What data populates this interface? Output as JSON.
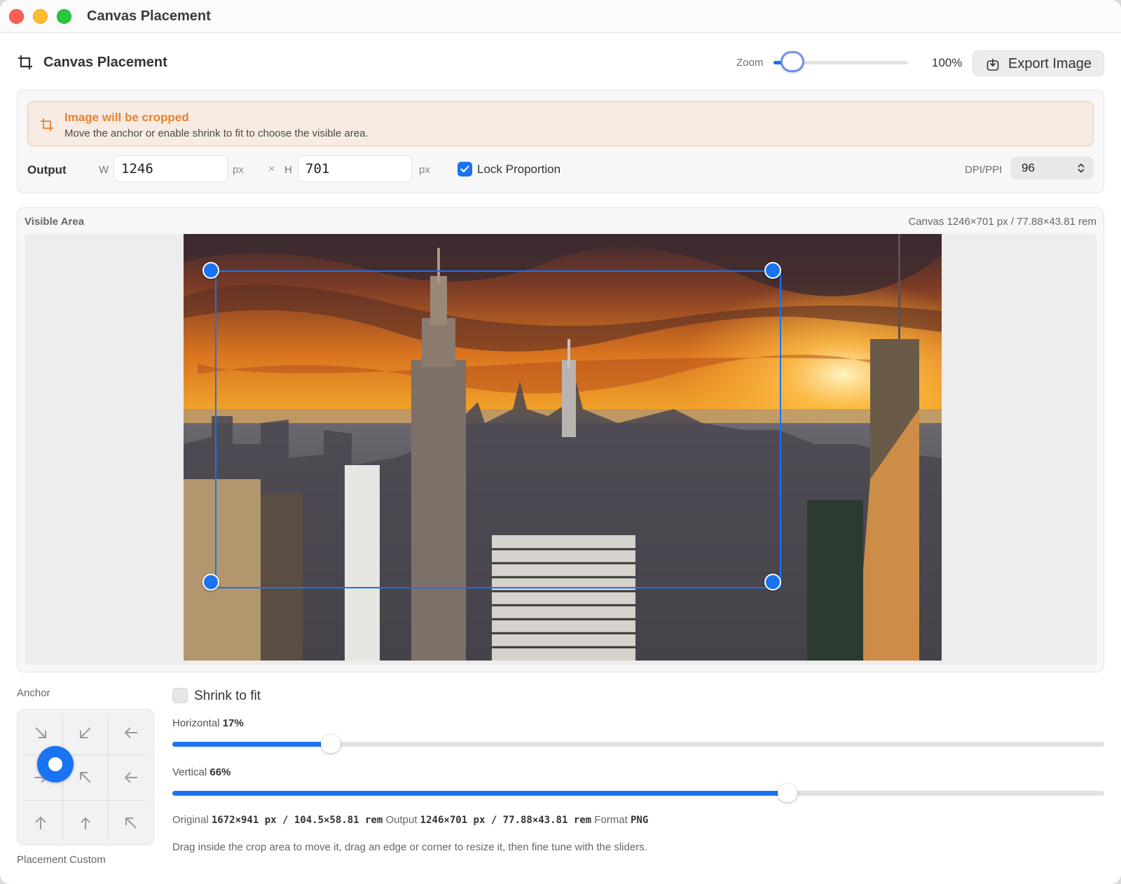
{
  "window": {
    "title": "Canvas Placement"
  },
  "toolbar": {
    "title": "Canvas Placement",
    "zoom_label": "Zoom",
    "zoom_value": "100%",
    "zoom_slider_fraction": 0.14,
    "export_label": "Export Image"
  },
  "warning": {
    "title": "Image will be cropped",
    "description": "Move the anchor or enable shrink to fit to choose the visible area."
  },
  "output": {
    "label": "Output",
    "w_label": "W",
    "width": "1246",
    "h_label": "H",
    "height": "701",
    "unit": "px",
    "times": "×",
    "lock_label": "Lock Proportion",
    "lock_checked": true,
    "dpi_label": "DPI/PPI",
    "dpi_value": "96"
  },
  "visible_area": {
    "label": "Visible Area",
    "canvas_info": "Canvas 1246×701 px / 77.88×43.81 rem"
  },
  "anchor": {
    "label": "Anchor",
    "placement": "Placement Custom",
    "icons": [
      "arrow-down-right-icon",
      "arrow-down-left-icon",
      "arrow-left-icon",
      "arrow-right-icon",
      "arrow-up-left-icon",
      "arrow-left-icon",
      "arrow-up-icon",
      "arrow-up-left-icon",
      "arrow-up-left-icon"
    ]
  },
  "shrink": {
    "label": "Shrink to fit",
    "checked": false
  },
  "sliders": {
    "horizontal": {
      "label": "Horizontal",
      "value": "17%",
      "fraction": 0.17
    },
    "vertical": {
      "label": "Vertical",
      "value": "66%",
      "fraction": 0.66
    }
  },
  "meta": {
    "original_label": "Original",
    "original_value": "1672×941 px / 104.5×58.81 rem",
    "output_label": "Output",
    "output_value": "1246×701 px / 77.88×43.81 rem",
    "format_label": "Format",
    "format_value": "PNG"
  },
  "hint": "Drag inside the crop area to move it, drag an edge or corner to resize it, then fine tune with the sliders.",
  "colors": {
    "accent": "#1a73f0",
    "warning": "#e9822c",
    "warning_bg": "#f7ebe3"
  }
}
